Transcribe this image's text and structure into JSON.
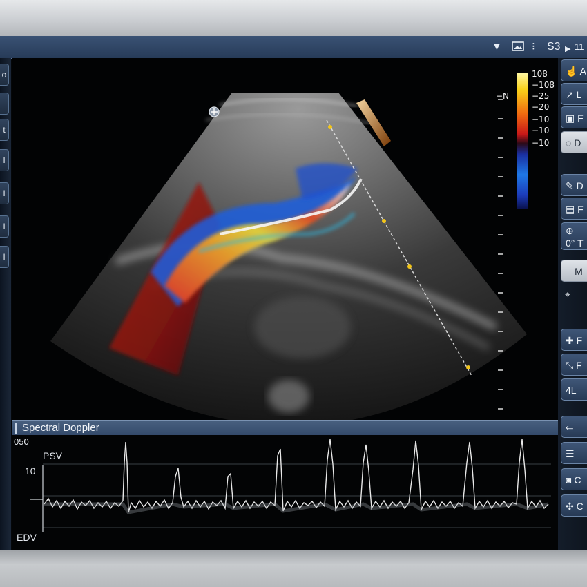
{
  "topbar": {
    "dropdown_icon": "caret-down-icon",
    "image_icon": "image-icon",
    "probe_label": "S3",
    "play_icon": "play-icon",
    "extra_text": "11"
  },
  "left_rail": {
    "buttons": [
      {
        "label": "o"
      },
      {
        "label": ""
      },
      {
        "label": "t"
      },
      {
        "label": "I"
      },
      {
        "label": "I"
      },
      {
        "label": "I"
      },
      {
        "label": "I"
      }
    ]
  },
  "right_rail": {
    "buttons": [
      {
        "label": "A",
        "icon": "hand-pointer-icon"
      },
      {
        "label": "L",
        "icon": "arrow-icon"
      },
      {
        "label": "F",
        "icon": "freeze-icon"
      },
      {
        "label": "D",
        "icon": "depth-icon"
      },
      {
        "label": "D",
        "icon": "edit-icon"
      },
      {
        "label": "F",
        "icon": "image-save-icon"
      },
      {
        "label": "0° T",
        "icon": "angle-icon"
      },
      {
        "label": "M",
        "icon": ""
      },
      {
        "label": "",
        "icon": "target-icon"
      },
      {
        "label": "F",
        "icon": "plus-icon"
      },
      {
        "label": "F",
        "icon": "caliper-icon"
      },
      {
        "label": "4L",
        "icon": "trace-icon"
      },
      {
        "label": "",
        "icon": "back-arrow-icon"
      },
      {
        "label": "",
        "icon": "menu-icon"
      },
      {
        "label": "C",
        "icon": "camera-icon"
      },
      {
        "label": "C",
        "icon": "settings-icon"
      }
    ]
  },
  "colorbar": {
    "labels": [
      "108",
      "−108",
      "−25",
      "−20",
      "−10",
      "−10",
      "−10"
    ],
    "side_label": "−N"
  },
  "spectral": {
    "title": "Spectral Doppler",
    "axis_top": "050",
    "axis_mid": "10",
    "psv_label": "PSV",
    "edv_label": "EDV"
  },
  "colors": {
    "panel_blue": "#33496a",
    "doppler_red": "#d9311c",
    "doppler_blue": "#1c5ee0",
    "marker_yellow": "#f2c51a"
  }
}
